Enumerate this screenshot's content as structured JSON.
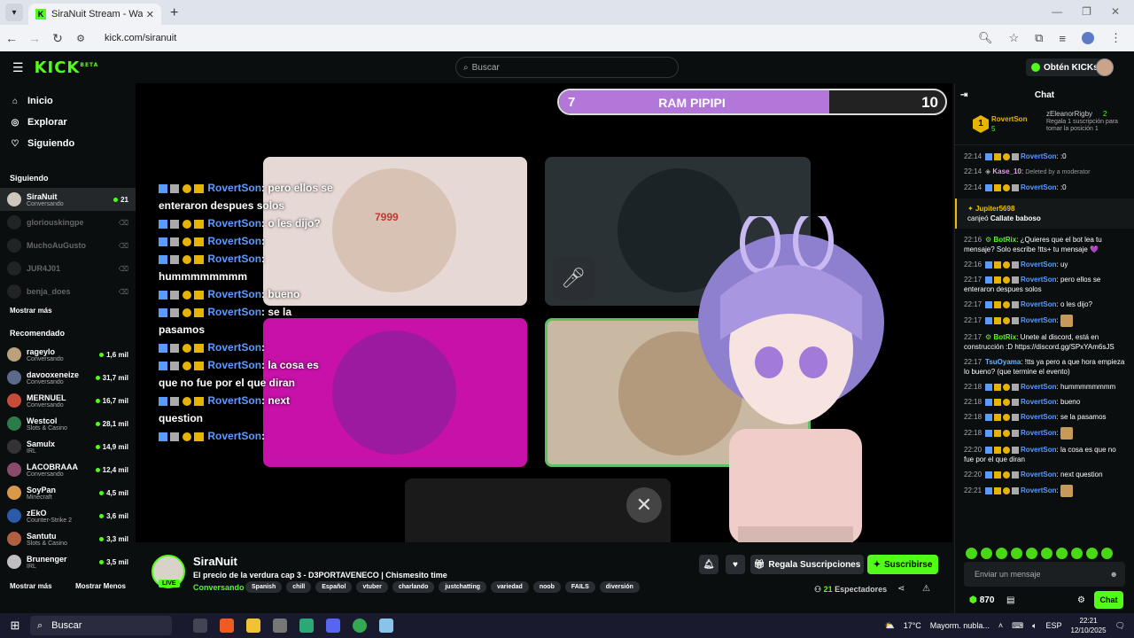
{
  "browser": {
    "tab_title": "SiraNuit Stream - Watch Live on",
    "url": "kick.com/siranuit"
  },
  "kick": {
    "search_placeholder": "Buscar",
    "get_kicks": "Obtén KICKs",
    "logo": "KICK",
    "logo_beta": "BETA"
  },
  "sidebar": {
    "nav": [
      {
        "label": "Inicio",
        "icon": "home-icon"
      },
      {
        "label": "Explorar",
        "icon": "compass-icon"
      },
      {
        "label": "Siguiendo",
        "icon": "heart-icon"
      }
    ],
    "following_title": "Siguiendo",
    "following": [
      {
        "name": "SiraNuit",
        "sub": "Conversando",
        "count": "21",
        "live": true
      },
      {
        "name": "gloriouskingpe",
        "live": false
      },
      {
        "name": "MuchoAuGusto",
        "live": false
      },
      {
        "name": "JUR4J01",
        "live": false
      },
      {
        "name": "benja_does",
        "live": false
      }
    ],
    "show_more": "Mostrar más",
    "recommended_title": "Recomendado",
    "recommended": [
      {
        "name": "rageylo",
        "sub": "Conversando",
        "count": "1,6 mil"
      },
      {
        "name": "davooxeneize",
        "sub": "Conversando",
        "count": "31,7 mil"
      },
      {
        "name": "MERNUEL",
        "sub": "Conversando",
        "count": "16,7 mil"
      },
      {
        "name": "Westcol",
        "sub": "Slots & Casino",
        "count": "28,1 mil"
      },
      {
        "name": "Samulx",
        "sub": "IRL",
        "count": "14,9 mil"
      },
      {
        "name": "LACOBRAAA",
        "sub": "Conversando",
        "count": "12,4 mil"
      },
      {
        "name": "SoyPan",
        "sub": "Minecraft",
        "count": "4,5 mil"
      },
      {
        "name": "zEkO",
        "sub": "Counter-Strike 2",
        "count": "3,6 mil"
      },
      {
        "name": "Santutu",
        "sub": "Slots & Casino",
        "count": "3,3 mil"
      },
      {
        "name": "Brunenger",
        "sub": "IRL",
        "count": "3,5 mil"
      }
    ],
    "show_more2": "Mostrar más",
    "show_less": "Mostrar Menos"
  },
  "video": {
    "ram_left": "7",
    "ram_title": "RAM PIPIPI",
    "ram_right": "10",
    "ram_progress": 0.7,
    "overlay_chat": [
      {
        "user": "RovertSon",
        "text": ": pero ellos se enteraron despues solos"
      },
      {
        "user": "RovertSon",
        "text": ": o les dijo?"
      },
      {
        "user": "RovertSon",
        "text": ":"
      },
      {
        "user": "RovertSon",
        "text": ": hummmmmmmm"
      },
      {
        "user": "RovertSon",
        "text": ": bueno"
      },
      {
        "user": "RovertSon",
        "text": ": se la pasamos"
      },
      {
        "user": "RovertSon",
        "text": ":"
      },
      {
        "user": "RovertSon",
        "text": ": la cosa es que no fue por el que diran"
      },
      {
        "user": "RovertSon",
        "text": ": next question"
      },
      {
        "user": "RovertSon",
        "text": ":"
      }
    ],
    "face_label": "7999"
  },
  "channel": {
    "name": "SiraNuit",
    "live": "LIVE",
    "title": "El precio de la verdura cap 3 - D3PORTAVENECO | Chismesito time",
    "category": "Conversando",
    "tags": [
      "Spanish",
      "chill",
      "Español",
      "vtuber",
      "charlando",
      "justchatting",
      "variedad",
      "noob",
      "FAILS",
      "diversión"
    ],
    "gift_subs": "Regala Suscripciones",
    "subscribe": "Suscribirse",
    "viewers": "21",
    "viewers_label": "Espectadores"
  },
  "chat": {
    "title": "Chat",
    "pinned": {
      "top_user": "RovertSon",
      "top_count": "5",
      "gift_user": "zEleanorRigby",
      "gift_count": "2",
      "gift_text": "Regala 1 suscripción para tomar la posición 1"
    },
    "messages": [
      {
        "time": "22:14",
        "user": "RovertSon",
        "text": ":0"
      },
      {
        "time": "22:14",
        "user": "Kase_10",
        "text": "Deleted by a moderator",
        "deleted": true
      },
      {
        "time": "22:14",
        "user": "RovertSon",
        "text": ":0"
      },
      {
        "redeem": true,
        "user": "Jupiter5698",
        "action": "canjeó",
        "item": "Callate baboso"
      },
      {
        "time": "22:16",
        "user": "BotRix",
        "bot": true,
        "text": "¿Quieres que el bot lea tu mensaje? Solo escribe !tts+ tu mensaje 💜"
      },
      {
        "time": "22:16",
        "user": "RovertSon",
        "text": "uy"
      },
      {
        "time": "22:17",
        "user": "RovertSon",
        "text": "pero ellos se enteraron despues solos"
      },
      {
        "time": "22:17",
        "user": "RovertSon",
        "text": "o les dijo?"
      },
      {
        "time": "22:17",
        "user": "RovertSon",
        "text": ""
      },
      {
        "time": "22:17",
        "user": "BotRix",
        "bot": true,
        "text": "Unete al discord, está en construcción :D https://discord.gg/SPxYAm6sJS"
      },
      {
        "time": "22:17",
        "user": "TsuOyama",
        "plain": true,
        "text": "!tts ya pero a que hora empieza lo bueno? (que termine el evento)"
      },
      {
        "time": "22:18",
        "user": "RovertSon",
        "text": "hummmmmmmm"
      },
      {
        "time": "22:18",
        "user": "RovertSon",
        "text": "bueno"
      },
      {
        "time": "22:18",
        "user": "RovertSon",
        "text": "se la pasamos"
      },
      {
        "time": "22:18",
        "user": "RovertSon",
        "text": ""
      },
      {
        "time": "22:20",
        "user": "RovertSon",
        "text": "la cosa es que no fue por el que diran"
      },
      {
        "time": "22:20",
        "user": "RovertSon",
        "text": "next question"
      },
      {
        "time": "22:21",
        "user": "RovertSon",
        "text": ""
      }
    ],
    "input_placeholder": "Enviar un mensaje",
    "kicks_balance": "870",
    "send": "Chat"
  },
  "taskbar": {
    "search": "Buscar",
    "weather": "17°C",
    "weather_text": "Mayorm. nubla...",
    "lang": "ESP",
    "time": "22:21",
    "date": "12/10/2025"
  },
  "colors": {
    "brand": "#53fc18",
    "username": "#5b9bff"
  }
}
